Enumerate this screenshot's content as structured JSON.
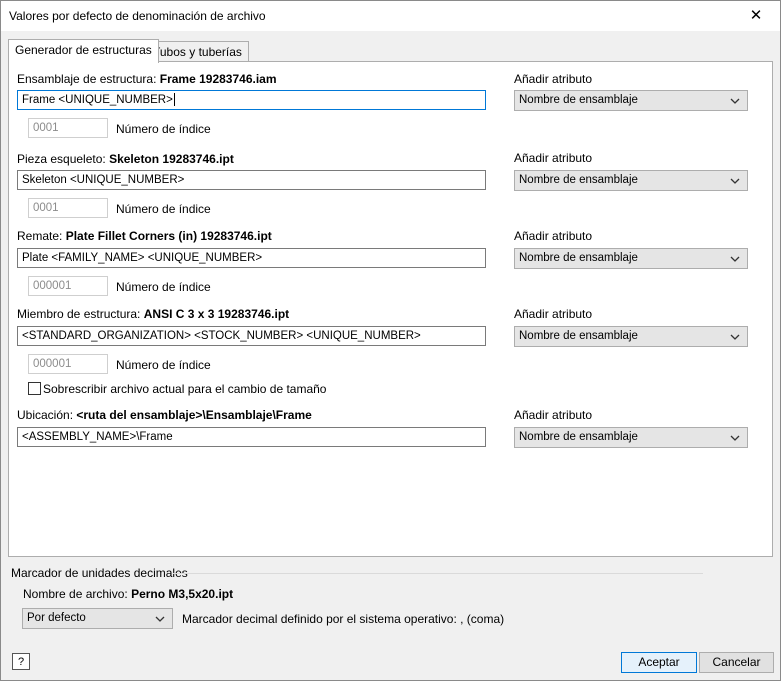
{
  "window": {
    "title": "Valores por defecto de denominación de archivo",
    "close_glyph": "✕"
  },
  "tabs": [
    {
      "label": "Generador de estructuras"
    },
    {
      "label": "Tubos y tuberías"
    }
  ],
  "add_attribute_label": "Añadir atributo",
  "index_label": "Número de índice",
  "sections": [
    {
      "label_prefix": "Ensamblaje de estructura:",
      "label_value": "Frame 19283746.iam",
      "input_value": "Frame <UNIQUE_NUMBER>",
      "index_value": "0001",
      "attribute_value": "Nombre de ensamblaje"
    },
    {
      "label_prefix": "Pieza esqueleto:",
      "label_value": "Skeleton 19283746.ipt",
      "input_value": "Skeleton <UNIQUE_NUMBER>",
      "index_value": "0001",
      "attribute_value": "Nombre de ensamblaje"
    },
    {
      "label_prefix": "Remate:",
      "label_value": "Plate Fillet Corners (in) 19283746.ipt",
      "input_value": "Plate <FAMILY_NAME> <UNIQUE_NUMBER>",
      "index_value": "000001",
      "attribute_value": "Nombre de ensamblaje"
    },
    {
      "label_prefix": "Miembro de estructura:",
      "label_value": "ANSI C 3 x 3 19283746.ipt",
      "input_value": "<STANDARD_ORGANIZATION> <STOCK_NUMBER> <UNIQUE_NUMBER>",
      "index_value": "000001",
      "attribute_value": "Nombre de ensamblaje"
    },
    {
      "label_prefix": "Ubicación:",
      "label_value": "<ruta del ensamblaje>\\Ensamblaje\\Frame",
      "input_value": "<ASSEMBLY_NAME>\\Frame",
      "attribute_value": "Nombre de ensamblaje"
    }
  ],
  "overwrite_checkbox": {
    "label": "Sobrescribir archivo actual para el cambio de tamaño",
    "checked": false
  },
  "decimal_group": {
    "title": "Marcador de unidades decimales",
    "filename_prefix": "Nombre de archivo:",
    "filename_value": "Perno M3,5x20.ipt",
    "select_value": "Por defecto",
    "os_marker_text": "Marcador decimal definido por el sistema operativo: , (coma)"
  },
  "footer": {
    "help_glyph": "?",
    "accept_label": "Aceptar",
    "cancel_label": "Cancelar"
  }
}
